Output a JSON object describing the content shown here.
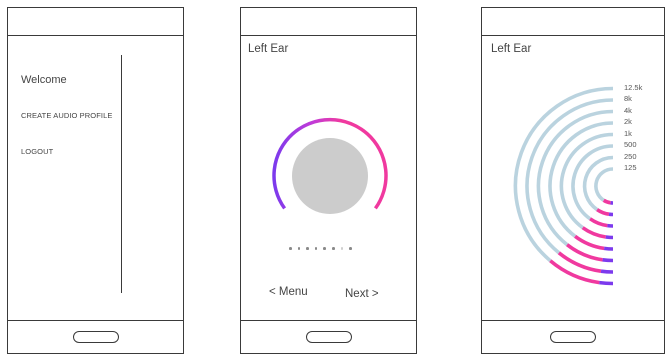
{
  "colors": {
    "arc_pink": "#f0399f",
    "arc_purple": "#7c3aed",
    "arc_blue": "#bad3df",
    "knob": "#cccccc",
    "frame": "#3a3a3a"
  },
  "screen1": {
    "welcome": "Welcome",
    "create_profile": "CREATE AUDIO PROFILE",
    "logout": "LOGOUT"
  },
  "screen2": {
    "title": "Left Ear",
    "progress": {
      "total_dots": 8,
      "current_dot": 7
    },
    "menu_label": "< Menu",
    "next_label": "Next >"
  },
  "screen3": {
    "title": "Left Ear",
    "frequencies": [
      "12.5k",
      "8k",
      "4k",
      "2k",
      "1k",
      "500",
      "250",
      "125"
    ]
  }
}
